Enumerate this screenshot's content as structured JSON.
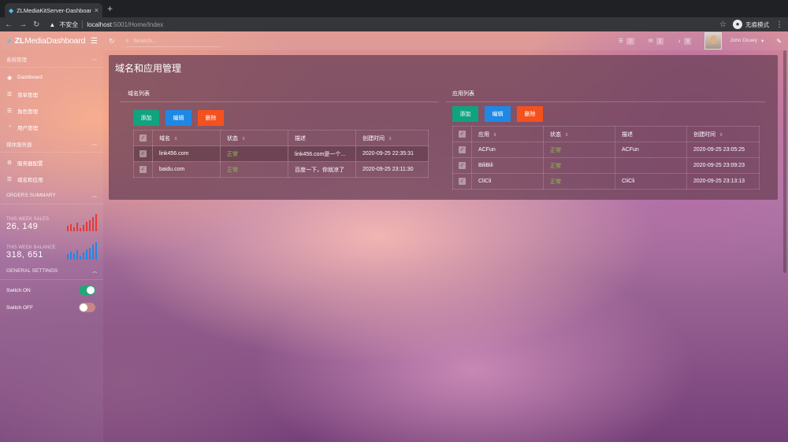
{
  "browser": {
    "tab_title": "ZLMediaKitServer-Dashboard",
    "security_label": "不安全",
    "url_host": "localhost",
    "url_path": ":5001/Home/Index",
    "incognito_label": "无痕模式"
  },
  "header": {
    "brand_bold": "ZL",
    "brand_rest": "MediaDashboard",
    "search_placeholder": "Search...",
    "messages_count": "2",
    "mail_count": "1",
    "notifications_count": "3",
    "user_name": "John Douey"
  },
  "sidebar": {
    "section_system": "系统管理",
    "items_system": [
      {
        "label": "Dashboard",
        "icon": "dashboard-icon"
      },
      {
        "label": "菜单管理",
        "icon": "list-icon"
      },
      {
        "label": "角色管理",
        "icon": "list-icon"
      },
      {
        "label": "用户管理",
        "icon": "user-icon"
      }
    ],
    "section_media": "媒体服务器",
    "items_media": [
      {
        "label": "服务器配置",
        "icon": "gear-icon"
      },
      {
        "label": "域名和应用",
        "icon": "list-icon"
      }
    ],
    "section_orders": "ORDERS SUMMARY",
    "week_sales_label": "THIS WEEK SALES",
    "week_sales_value": "26, 149",
    "week_balance_label": "THIS WEEK BALANCE",
    "week_balance_value": "318, 651",
    "sales_bars": [
      0.3,
      0.4,
      0.25,
      0.5,
      0.2,
      0.35,
      0.55,
      0.65,
      0.8,
      1.0
    ],
    "balance_bars": [
      0.3,
      0.45,
      0.35,
      0.55,
      0.2,
      0.4,
      0.6,
      0.7,
      0.85,
      1.0
    ],
    "sales_color": "#e53935",
    "balance_color": "#1e88e5",
    "section_settings": "GENERAL SETTINGS",
    "switch_on_label": "Switch ON",
    "switch_off_label": "Switch OFF"
  },
  "main": {
    "page_title": "域名和应用管理",
    "domain_section": "域名列表",
    "app_section": "应用列表",
    "btn_add": "添加",
    "btn_edit": "编辑",
    "btn_delete": "删除",
    "domain_headers": [
      "域名",
      "状态",
      "描述",
      "创建时间"
    ],
    "domain_rows": [
      {
        "name": "link456.com",
        "status": "正常",
        "desc": "link456.com是一个...",
        "time": "2020-09-25 22:35:31"
      },
      {
        "name": "baidu.com",
        "status": "正常",
        "desc": "百度一下，你就凉了",
        "time": "2020-09-25 23:11:30"
      }
    ],
    "app_headers": [
      "应用",
      "状态",
      "描述",
      "创建时间"
    ],
    "app_rows": [
      {
        "name": "ACFun",
        "status": "正常",
        "desc": "ACFun",
        "time": "2020-09-25 23:05:25"
      },
      {
        "name": "BiliBili",
        "status": "正常",
        "desc": "",
        "time": "2020-09-25 23:09:23"
      },
      {
        "name": "CliCli",
        "status": "正常",
        "desc": "CliCli",
        "time": "2020-09-25 23:13:13"
      }
    ]
  },
  "colors": {
    "add": "#10a37f",
    "edit": "#1e88e5",
    "delete": "#f4511e",
    "status_ok": "#8bc34a"
  }
}
